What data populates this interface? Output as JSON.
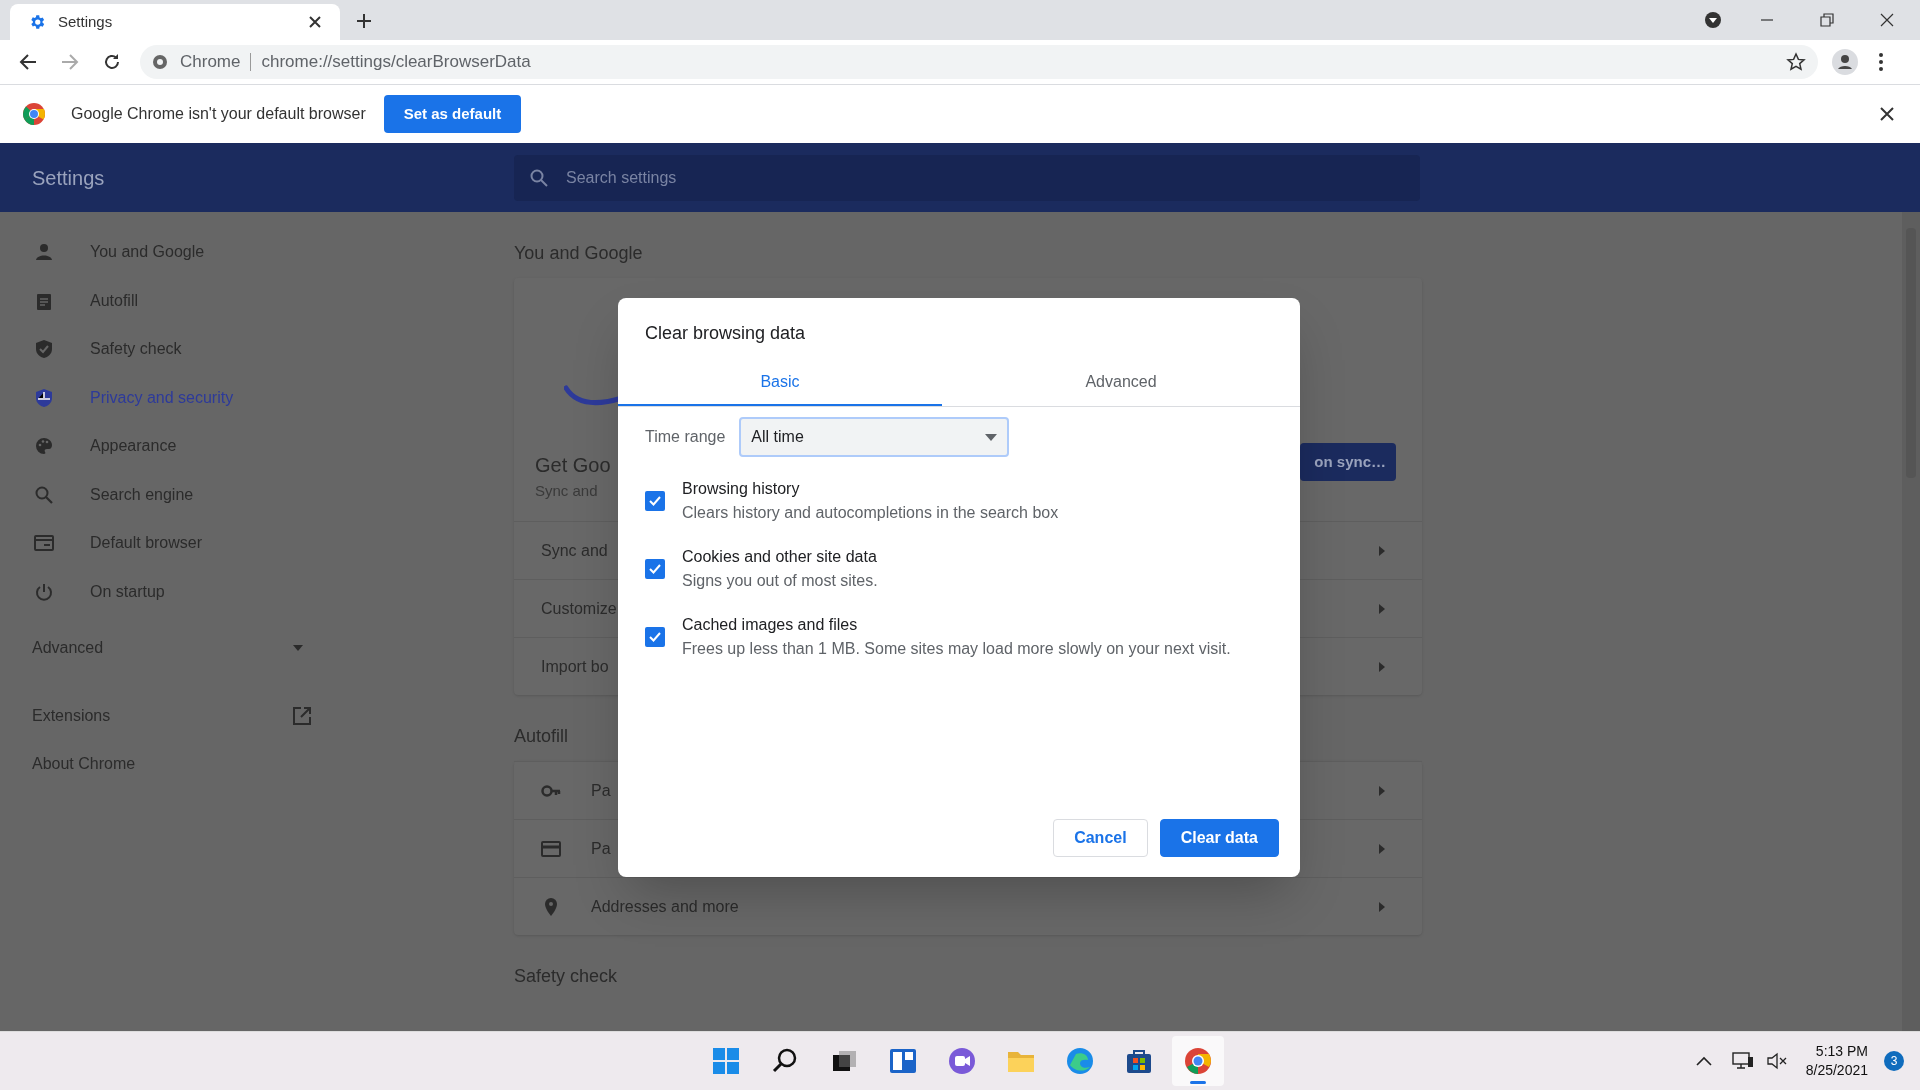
{
  "browser": {
    "tab": {
      "title": "Settings"
    },
    "address_bar": {
      "origin": "Chrome",
      "url": "chrome://settings/clearBrowserData"
    }
  },
  "infobar": {
    "message": "Google Chrome isn't your default browser",
    "button": "Set as default"
  },
  "header": {
    "title": "Settings",
    "search": {
      "placeholder": "Search settings"
    }
  },
  "sidebar": {
    "items": [
      {
        "label": "You and Google",
        "selected": false
      },
      {
        "label": "Autofill",
        "selected": false
      },
      {
        "label": "Safety check",
        "selected": false
      },
      {
        "label": "Privacy and security",
        "selected": true
      },
      {
        "label": "Appearance",
        "selected": false
      },
      {
        "label": "Search engine",
        "selected": false
      },
      {
        "label": "Default browser",
        "selected": false
      },
      {
        "label": "On startup",
        "selected": false
      }
    ],
    "advanced": {
      "label": "Advanced",
      "expanded": false
    },
    "links": [
      {
        "label": "Extensions",
        "external": true
      },
      {
        "label": "About Chrome",
        "external": false
      }
    ]
  },
  "main": {
    "sections": [
      {
        "heading": "You and Google",
        "sync_promo": {
          "title": "Get Goo",
          "subtitle": "Sync and",
          "button": "on sync…"
        },
        "rows": [
          {
            "label": "Sync and"
          },
          {
            "label": "Customize"
          },
          {
            "label": "Import bo"
          }
        ]
      },
      {
        "heading": "Autofill",
        "rows": [
          {
            "label": "Pa"
          },
          {
            "label": "Pa"
          },
          {
            "label": "Addresses and more"
          }
        ]
      },
      {
        "heading": "Safety check"
      }
    ]
  },
  "dialog": {
    "title": "Clear browsing data",
    "tabs": [
      {
        "label": "Basic",
        "selected": true
      },
      {
        "label": "Advanced",
        "selected": false
      }
    ],
    "time_range": {
      "label": "Time range",
      "value": "All time"
    },
    "options": [
      {
        "title": "Browsing history",
        "description": "Clears history and autocompletions in the search box",
        "checked": true
      },
      {
        "title": "Cookies and other site data",
        "description": "Signs you out of most sites.",
        "checked": true
      },
      {
        "title": "Cached images and files",
        "description": "Frees up less than 1 MB. Some sites may load more slowly on your next visit.",
        "checked": true
      }
    ],
    "buttons": [
      {
        "label": "Cancel",
        "kind": "secondary"
      },
      {
        "label": "Clear data",
        "kind": "primary"
      }
    ]
  },
  "taskbar": {
    "apps": [
      {
        "active": false
      },
      {
        "active": false
      },
      {
        "active": false
      },
      {
        "active": false
      },
      {
        "active": false
      },
      {
        "active": false
      },
      {
        "active": false
      },
      {
        "active": false
      },
      {
        "active": true
      }
    ],
    "clock": {
      "time": "5:13 PM",
      "date": "8/25/2021"
    },
    "notifications": {
      "count": "3"
    }
  }
}
